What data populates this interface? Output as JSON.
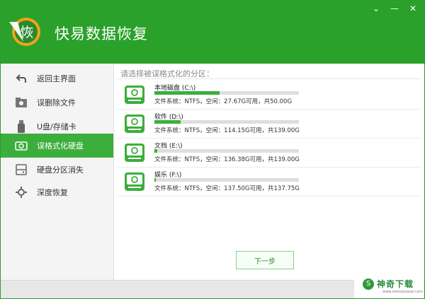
{
  "app": {
    "title": "快易数据恢复",
    "logo_glyph": "恢",
    "controls": {
      "collapse": "⌄",
      "minimize": "—",
      "close": "✕"
    }
  },
  "sidebar": {
    "items": [
      {
        "label": "返回主界面",
        "icon": "back-arrow-icon"
      },
      {
        "label": "误删除文件",
        "icon": "trash-folder-icon"
      },
      {
        "label": "U盘/存储卡",
        "icon": "usb-drive-icon"
      },
      {
        "label": "误格式化硬盘",
        "icon": "format-disk-icon",
        "active": true
      },
      {
        "label": "硬盘分区消失",
        "icon": "partition-icon"
      },
      {
        "label": "深度恢复",
        "icon": "deep-recover-icon"
      }
    ]
  },
  "main": {
    "prompt": "请选择被误格式化的分区：",
    "disks": [
      {
        "name": "本地磁盘 (C:\\)",
        "info": "文件系统：NTFS，空闲：27.67G可用，共50.00G",
        "used_fraction": 0.45
      },
      {
        "name": "软件 (D:\\)",
        "info": "文件系统：NTFS，空闲：114.15G可用，共139.00G",
        "used_fraction": 0.18
      },
      {
        "name": "文档 (E:\\)",
        "info": "文件系统：NTFS，空闲：136.38G可用，共139.00G",
        "used_fraction": 0.02
      },
      {
        "name": "娱乐 (F:\\)",
        "info": "文件系统：NTFS，空闲：137.50G可用，共137.75G",
        "used_fraction": 0.002
      }
    ],
    "next_button": "下一步"
  },
  "watermark": {
    "text": "神奇下载",
    "sub": "www.shenqixiazai.com",
    "badge": "S"
  },
  "colors": {
    "accent": "#2aa12a",
    "active_nav": "#3cae3c",
    "bar_fill": "#3cae3c"
  }
}
